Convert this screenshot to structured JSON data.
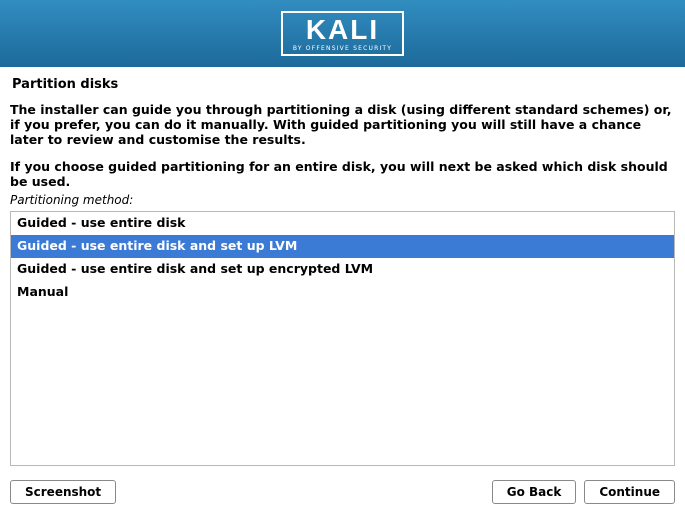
{
  "banner": {
    "logo_text": "KALI",
    "logo_sub": "BY OFFENSIVE SECURITY"
  },
  "title": "Partition disks",
  "intro": "The installer can guide you through partitioning a disk (using different standard schemes) or, if you prefer, you can do it manually. With guided partitioning you will still have a chance later to review and customise the results.",
  "intro2": "If you choose guided partitioning for an entire disk, you will next be asked which disk should be used.",
  "method_label": "Partitioning method:",
  "options": [
    {
      "label": "Guided - use entire disk",
      "selected": false
    },
    {
      "label": "Guided - use entire disk and set up LVM",
      "selected": true
    },
    {
      "label": "Guided - use entire disk and set up encrypted LVM",
      "selected": false
    },
    {
      "label": "Manual",
      "selected": false
    }
  ],
  "buttons": {
    "screenshot": "Screenshot",
    "goback": "Go Back",
    "continue": "Continue"
  }
}
